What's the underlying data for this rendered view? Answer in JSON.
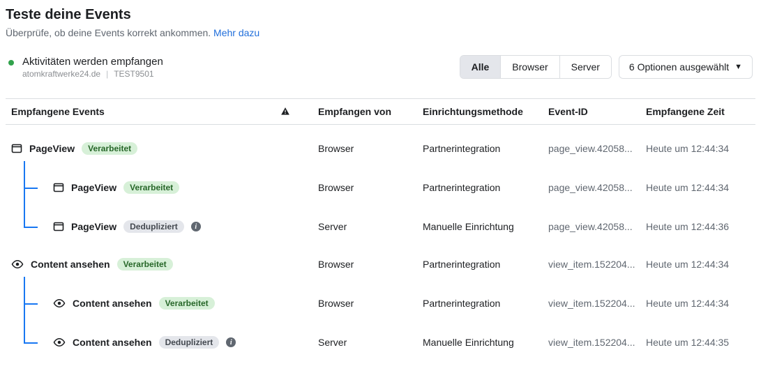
{
  "header": {
    "title": "Teste deine Events",
    "subtitle_text": "Überprüfe, ob deine Events korrekt ankommen. ",
    "subtitle_link": "Mehr dazu"
  },
  "status": {
    "text": "Aktivitäten werden empfangen",
    "domain": "atomkraftwerke24.de",
    "test_id": "TEST9501"
  },
  "filters": {
    "all": "Alle",
    "browser": "Browser",
    "server": "Server"
  },
  "options_btn": {
    "label": "6 Optionen ausgewählt"
  },
  "columns": {
    "event": "Empfangene Events",
    "from": "Empfangen von",
    "method": "Einrichtungsmethode",
    "id": "Event-ID",
    "time": "Empfangene Zeit"
  },
  "badges": {
    "processed": "Verarbeitet",
    "dedup": "Dedupliziert"
  },
  "groups": [
    {
      "icon": "box",
      "name": "PageView",
      "badge": "processed",
      "from": "Browser",
      "method": "Partnerintegration",
      "id": "page_view.42058...",
      "time": "Heute um 12:44:34",
      "children": [
        {
          "icon": "box",
          "name": "PageView",
          "badge": "processed",
          "from": "Browser",
          "method": "Partnerintegration",
          "id": "page_view.42058...",
          "time": "Heute um 12:44:34"
        },
        {
          "icon": "box",
          "name": "PageView",
          "badge": "dedup",
          "info": true,
          "from": "Server",
          "method": "Manuelle Einrichtung",
          "id": "page_view.42058...",
          "time": "Heute um 12:44:36"
        }
      ]
    },
    {
      "icon": "eye",
      "name": "Content ansehen",
      "badge": "processed",
      "from": "Browser",
      "method": "Partnerintegration",
      "id": "view_item.152204...",
      "time": "Heute um 12:44:34",
      "children": [
        {
          "icon": "eye",
          "name": "Content ansehen",
          "badge": "processed",
          "from": "Browser",
          "method": "Partnerintegration",
          "id": "view_item.152204...",
          "time": "Heute um 12:44:34"
        },
        {
          "icon": "eye",
          "name": "Content ansehen",
          "badge": "dedup",
          "info": true,
          "from": "Server",
          "method": "Manuelle Einrichtung",
          "id": "view_item.152204...",
          "time": "Heute um 12:44:35"
        }
      ]
    }
  ]
}
